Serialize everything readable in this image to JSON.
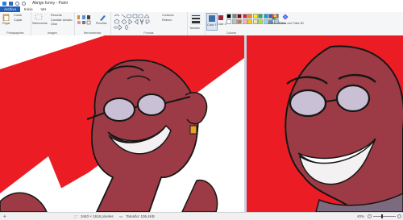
{
  "window": {
    "title": "Abrigo funny - Paint"
  },
  "tabs": [
    {
      "label": "Archivo"
    },
    {
      "label": "Inicio"
    },
    {
      "label": "Ver"
    }
  ],
  "ribbon": {
    "clipboard": {
      "paste": "Pegar",
      "cut": "Cortar",
      "copy": "Copiar",
      "group": "Portapapeles"
    },
    "image": {
      "select": "Seleccionar",
      "crop": "Recortar",
      "resize": "Cambiar tamaño",
      "rotate": "Girar",
      "group": "Imagen"
    },
    "tools": {
      "brushes": "Pinceles",
      "group": "Herramientas"
    },
    "shapes": {
      "outline": "Contorno",
      "fill": "Relleno",
      "group": "Formas"
    },
    "size": {
      "label": "Tamaño"
    },
    "colors": {
      "color1": "Color 1",
      "color2": "Color 2",
      "edit": "Editar colores",
      "paint3d": "Editar con Paint 3D",
      "group": "Colores",
      "color1_value": "#3e6ea8",
      "color2_value": "#9c2a3a",
      "palette": [
        "#000000",
        "#7f7f7f",
        "#880015",
        "#ed1c24",
        "#ff7f27",
        "#fff200",
        "#22b14c",
        "#00a2e8",
        "#3f48cc",
        "#a349a4",
        "#ffffff",
        "#c3c3c3",
        "#b97a57",
        "#ffaec9",
        "#ffc90e",
        "#efe4b0",
        "#b5e61d",
        "#99d9ea",
        "#7092be",
        "#c8bfe7"
      ]
    }
  },
  "status": {
    "dimensions": "3440 × 1616 píxeles",
    "size": "Tamaño: 106,4KB",
    "zoom": "40%"
  }
}
